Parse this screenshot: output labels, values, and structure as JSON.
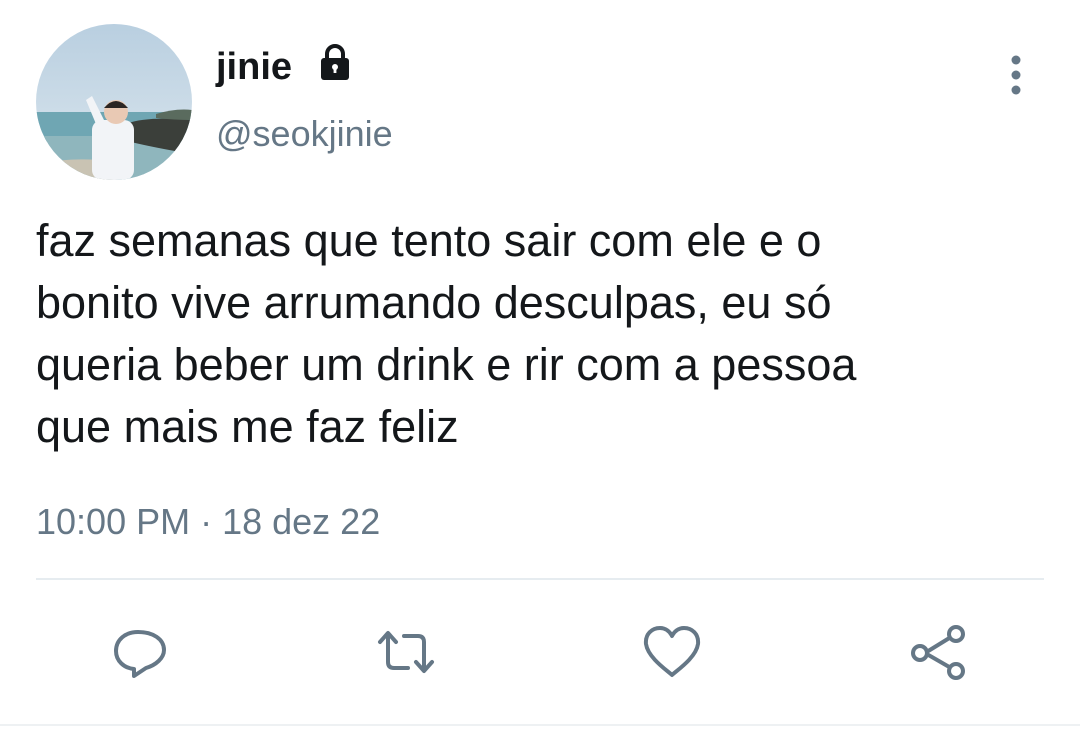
{
  "tweet": {
    "display_name": "jinie",
    "handle": "@seokjinie",
    "text_lines": [
      "faz semanas que tento sair com ele e o",
      "bonito vive arrumando desculpas, eu só",
      "queria beber um drink e rir com a pessoa",
      "que mais me faz feliz"
    ],
    "timestamp": "10:00 PM · 18 dez 22"
  },
  "icons": {
    "lock": "lock-icon",
    "more": "more-vertical-icon",
    "reply": "reply-icon",
    "retweet": "retweet-icon",
    "like": "heart-icon",
    "share": "share-icon"
  },
  "colors": {
    "text": "#14171a",
    "secondary": "#657786",
    "icon": "#657786",
    "divider": "#e6ecf0"
  }
}
